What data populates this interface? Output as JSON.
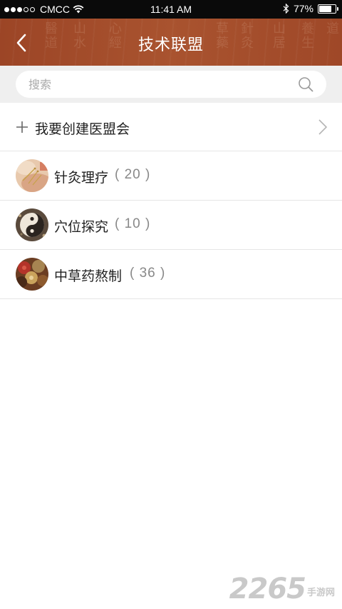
{
  "status_bar": {
    "carrier": "CMCC",
    "time": "11:41 AM",
    "battery_text": "77%",
    "battery_level": 0.77,
    "signal_bars_filled": 3,
    "signal_bars_total": 5
  },
  "header": {
    "title": "技术联盟",
    "back_icon": "chevron-left-icon",
    "background_color": "#a24b2a"
  },
  "search": {
    "placeholder": "搜索",
    "value": "",
    "icon": "search-icon"
  },
  "create": {
    "label": "我要创建医盟会",
    "icon": "plus-icon",
    "chevron_icon": "chevron-right-icon"
  },
  "groups": [
    {
      "name": "针灸理疗",
      "count": "( 20 )"
    },
    {
      "name": "穴位探究",
      "count": "( 10 )"
    },
    {
      "name": "中草药熬制",
      "count": "( 36 )"
    }
  ],
  "watermark": {
    "number": "2265",
    "text": "手游网"
  }
}
